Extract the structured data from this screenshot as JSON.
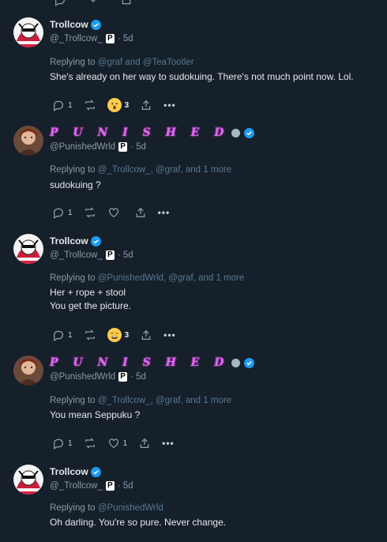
{
  "colors": {
    "background": "#15202b",
    "text": "#e7e9ea",
    "muted": "#8b98a5",
    "verified": "#1d9bf0",
    "stylized_name": "#e066ff"
  },
  "replies": [
    {
      "display_name": "Trollcow",
      "stylized": false,
      "handle": "@_Trollcow_",
      "time": "· 5d",
      "replying_prefix": "Replying to",
      "replying_mentions": "@graf and @TeaTootler",
      "text": "She's already on her way to sudokuing. There's not much point now. Lol.",
      "reply_count": "1",
      "reaction": "surprised-emoji",
      "reaction_count": "3",
      "avatar": "trollcow-avatar"
    },
    {
      "display_name": "P U N I S H E D",
      "stylized": true,
      "handle": "@PunishedWrld",
      "time": "· 5d",
      "replying_prefix": "Replying to",
      "replying_mentions": "@_Trollcow_, @graf, and 1 more",
      "text": "sudokuing ?",
      "reply_count": "1",
      "reaction": "heart",
      "reaction_count": "",
      "avatar": "punished-avatar"
    },
    {
      "display_name": "Trollcow",
      "stylized": false,
      "handle": "@_Trollcow_",
      "time": "· 5d",
      "replying_prefix": "Replying to",
      "replying_mentions": "@PunishedWrld, @graf, and 1 more",
      "text": "Her + rope + stool\nYou get the picture.",
      "reply_count": "1",
      "reaction": "weary-emoji",
      "reaction_count": "3",
      "avatar": "trollcow-avatar"
    },
    {
      "display_name": "P U N I S H E D",
      "stylized": true,
      "handle": "@PunishedWrld",
      "time": "· 5d",
      "replying_prefix": "Replying to",
      "replying_mentions": "@_Trollcow_, @graf, and 1 more",
      "text": "You mean Seppuku ?",
      "reply_count": "1",
      "reaction": "heart",
      "reaction_count": "1",
      "avatar": "punished-avatar"
    },
    {
      "display_name": "Trollcow",
      "stylized": false,
      "handle": "@_Trollcow_",
      "time": "· 5d",
      "replying_prefix": "Replying to",
      "replying_mentions": "@PunishedWrld",
      "text": "Oh darling. You're so pure. Never change.",
      "reply_count": "",
      "reaction": "",
      "reaction_count": "",
      "avatar": "trollcow-avatar"
    }
  ]
}
